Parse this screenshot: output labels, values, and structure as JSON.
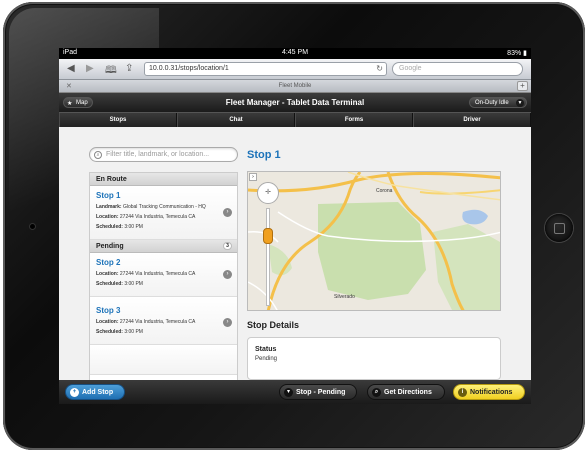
{
  "status_bar": {
    "carrier": "iPad",
    "time": "4:45 PM",
    "battery": "83%"
  },
  "browser": {
    "url": "10.0.0.31/stops/location/1",
    "search_placeholder": "Google",
    "tab_title": "Fleet Mobile"
  },
  "header": {
    "map_label": "Map",
    "title": "Fleet Manager - Tablet Data Terminal",
    "duty_status": "On-Duty Idle"
  },
  "nav_tabs": [
    "Stops",
    "Chat",
    "Forms",
    "Driver"
  ],
  "filter": {
    "placeholder": "Filter title, landmark, or location..."
  },
  "list": {
    "enroute_label": "En Route",
    "pending_label": "Pending",
    "pending_count": "3",
    "stops": [
      {
        "name": "Stop 1",
        "landmark_label": "Landmark:",
        "landmark": "Global Tracking Communication - HQ",
        "location_label": "Location:",
        "location": "27244 Via Industria, Temecula CA",
        "scheduled_label": "Scheduled:",
        "scheduled": "3:00 PM"
      },
      {
        "name": "Stop 2",
        "location_label": "Location:",
        "location": "27244 Via Industria, Temecula CA",
        "scheduled_label": "Scheduled:",
        "scheduled": "3:00 PM"
      },
      {
        "name": "Stop 3",
        "location_label": "Location:",
        "location": "27244 Via Industria, Temecula CA",
        "scheduled_label": "Scheduled:",
        "scheduled": "3:00 PM"
      }
    ]
  },
  "detail": {
    "title": "Stop 1",
    "map_labels": {
      "corona": "Corona",
      "silverado": "Silverado"
    },
    "details_heading": "Stop Details",
    "status_label": "Status",
    "status_value": "Pending"
  },
  "footer": {
    "add_stop": "Add Stop",
    "stop_status": "Stop - Pending",
    "directions": "Get Directions",
    "notifications": "Notifications"
  },
  "colors": {
    "accent_blue": "#1d73b9",
    "notification_yellow": "#f1cf21"
  }
}
